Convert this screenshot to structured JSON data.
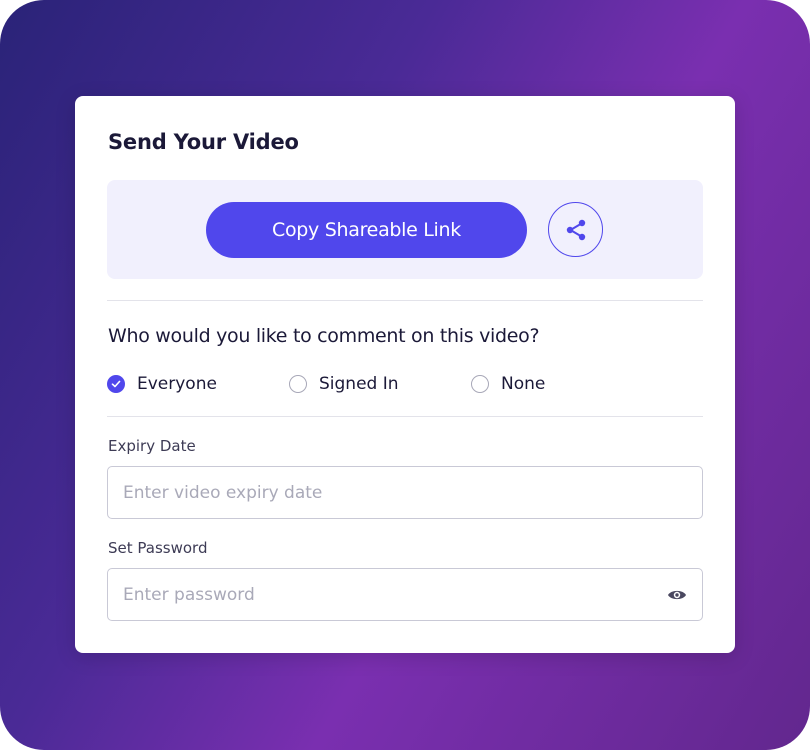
{
  "dialog": {
    "title": "Send Your Video"
  },
  "share": {
    "copy_label": "Copy Shareable Link",
    "icon": "share-icon"
  },
  "comments": {
    "question": "Who would you like to comment on this video?",
    "options": [
      {
        "label": "Everyone",
        "checked": true
      },
      {
        "label": "Signed In",
        "checked": false
      },
      {
        "label": "None",
        "checked": false
      }
    ]
  },
  "expiry": {
    "label": "Expiry Date",
    "value": "",
    "placeholder": "Enter video expiry date"
  },
  "password": {
    "label": "Set Password",
    "value": "",
    "placeholder": "Enter password",
    "visibility_icon": "eye-icon"
  },
  "colors": {
    "accent": "#5047ec",
    "panel_bg": "#f1f0fd",
    "text_dark": "#1b1938",
    "placeholder": "#a9a9b8"
  }
}
